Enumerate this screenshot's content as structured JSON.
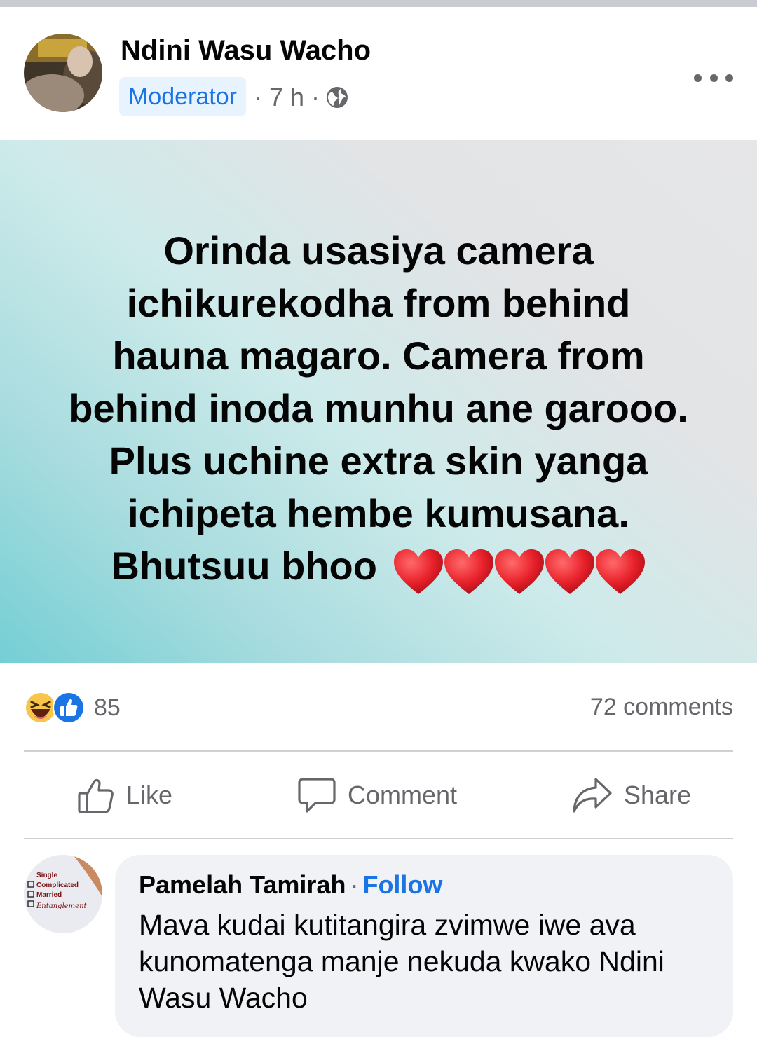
{
  "post": {
    "author": "Ndini Wasu Wacho",
    "role_badge": "Moderator",
    "time": "7 h",
    "audience_icon": "globe-icon",
    "more_icon": "more-options-icon",
    "text_lines": [
      "Orinda usasiya camera",
      "ichikurekodha from behind",
      "hauna magaro. Camera from",
      "behind inoda munhu ane garooo.",
      "Plus uchine extra skin yanga",
      "ichipeta hembe kumusana.",
      "Bhutsuu bhoo"
    ],
    "emoji": [
      "heart",
      "heart",
      "heart",
      "heart",
      "heart"
    ],
    "background_colors": [
      "#74cfd4",
      "#e6e6e8"
    ]
  },
  "stats": {
    "reaction_icons": [
      "haha-icon",
      "like-icon"
    ],
    "reaction_count": "85",
    "comments": "72 comments"
  },
  "actions": {
    "like": "Like",
    "comment": "Comment",
    "share": "Share"
  },
  "comment": {
    "author": "Pamelah Tamirah",
    "separator": "·",
    "follow": "Follow",
    "text": "Mava kudai kutitangira zvimwe iwe ava kunomatenga manje nekuda kwako Ndini Wasu Wacho",
    "avatar_text": [
      "Single",
      "Complicated",
      "Married",
      "Entanglement"
    ]
  },
  "colors": {
    "accent": "#1b74e4",
    "secondary_text": "#65676b",
    "badge_bg": "#e7f3ff",
    "bubble_bg": "#f0f2f5",
    "heart": "#e8202a"
  }
}
